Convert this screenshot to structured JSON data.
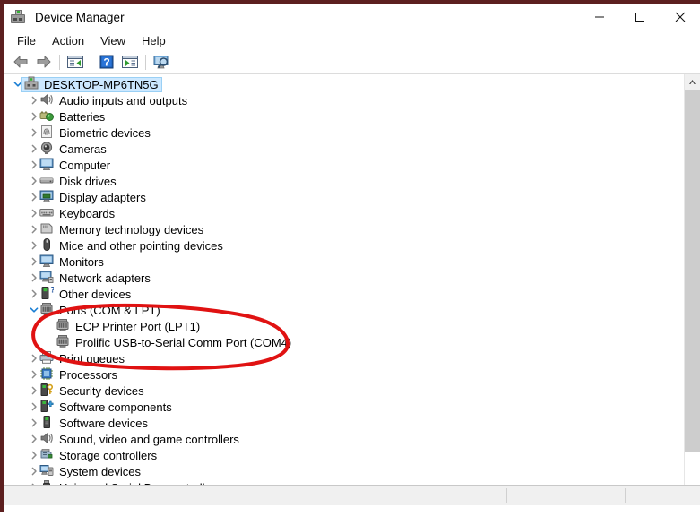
{
  "window": {
    "title": "Device Manager",
    "icon": "device-manager-icon",
    "border_color": "#5c1f1f",
    "controls": [
      {
        "name": "minimize",
        "glyph": "minimize-icon"
      },
      {
        "name": "maximize",
        "glyph": "maximize-icon"
      },
      {
        "name": "close",
        "glyph": "close-icon"
      }
    ]
  },
  "menubar": {
    "items": [
      "File",
      "Action",
      "View",
      "Help"
    ]
  },
  "toolbar": {
    "buttons": [
      {
        "name": "back-button",
        "icon": "back-arrow-icon"
      },
      {
        "name": "forward-button",
        "icon": "forward-arrow-icon"
      },
      {
        "name": "show-hide-console-tree-button",
        "icon": "console-tree-icon"
      },
      {
        "name": "help-button",
        "icon": "question-mark-icon"
      },
      {
        "name": "properties-button",
        "icon": "properties-panel-icon"
      },
      {
        "name": "scan-for-hardware-changes-button",
        "icon": "monitor-scan-icon"
      }
    ]
  },
  "tree": {
    "selected": "DESKTOP-MP6TN5G",
    "nodes": [
      {
        "label": "DESKTOP-MP6TN5G",
        "depth": 0,
        "state": "expanded",
        "icon": "computer-device-icon",
        "selected": true
      },
      {
        "label": "Audio inputs and outputs",
        "depth": 1,
        "state": "collapsed",
        "icon": "speaker-icon"
      },
      {
        "label": "Batteries",
        "depth": 1,
        "state": "collapsed",
        "icon": "battery-icon"
      },
      {
        "label": "Biometric devices",
        "depth": 1,
        "state": "collapsed",
        "icon": "fingerprint-icon"
      },
      {
        "label": "Cameras",
        "depth": 1,
        "state": "collapsed",
        "icon": "camera-icon"
      },
      {
        "label": "Computer",
        "depth": 1,
        "state": "collapsed",
        "icon": "monitor-icon"
      },
      {
        "label": "Disk drives",
        "depth": 1,
        "state": "collapsed",
        "icon": "disk-drive-icon"
      },
      {
        "label": "Display adapters",
        "depth": 1,
        "state": "collapsed",
        "icon": "display-adapter-icon"
      },
      {
        "label": "Keyboards",
        "depth": 1,
        "state": "collapsed",
        "icon": "keyboard-icon"
      },
      {
        "label": "Memory technology devices",
        "depth": 1,
        "state": "collapsed",
        "icon": "memory-card-icon"
      },
      {
        "label": "Mice and other pointing devices",
        "depth": 1,
        "state": "collapsed",
        "icon": "mouse-icon"
      },
      {
        "label": "Monitors",
        "depth": 1,
        "state": "collapsed",
        "icon": "monitor-icon"
      },
      {
        "label": "Network adapters",
        "depth": 1,
        "state": "collapsed",
        "icon": "network-adapter-icon"
      },
      {
        "label": "Other devices",
        "depth": 1,
        "state": "collapsed",
        "icon": "unknown-device-icon"
      },
      {
        "label": "Ports (COM & LPT)",
        "depth": 1,
        "state": "expanded",
        "icon": "port-icon"
      },
      {
        "label": "ECP Printer Port (LPT1)",
        "depth": 2,
        "state": "leaf",
        "icon": "port-icon"
      },
      {
        "label": "Prolific USB-to-Serial Comm Port (COM4)",
        "depth": 2,
        "state": "leaf",
        "icon": "port-icon"
      },
      {
        "label": "Print queues",
        "depth": 1,
        "state": "collapsed",
        "icon": "printer-icon"
      },
      {
        "label": "Processors",
        "depth": 1,
        "state": "collapsed",
        "icon": "processor-icon"
      },
      {
        "label": "Security devices",
        "depth": 1,
        "state": "collapsed",
        "icon": "security-key-icon"
      },
      {
        "label": "Software components",
        "depth": 1,
        "state": "collapsed",
        "icon": "software-component-icon"
      },
      {
        "label": "Software devices",
        "depth": 1,
        "state": "collapsed",
        "icon": "software-device-icon"
      },
      {
        "label": "Sound, video and game controllers",
        "depth": 1,
        "state": "collapsed",
        "icon": "speaker-icon"
      },
      {
        "label": "Storage controllers",
        "depth": 1,
        "state": "collapsed",
        "icon": "storage-controller-icon"
      },
      {
        "label": "System devices",
        "depth": 1,
        "state": "collapsed",
        "icon": "system-device-icon"
      },
      {
        "label": "Universal Serial Bus controllers",
        "depth": 1,
        "state": "collapsed",
        "icon": "usb-icon"
      }
    ]
  },
  "scrollbar": {
    "up_arrow": "scroll-up-icon",
    "orientation": "vertical"
  },
  "annotation": {
    "shape": "hand-drawn-ellipse",
    "color": "#e01212",
    "stroke_width": 4,
    "encircles": [
      "Ports (COM & LPT)",
      "ECP Printer Port (LPT1)",
      "Prolific USB-to-Serial Comm Port (COM4)"
    ]
  },
  "statusbar": {
    "text": ""
  }
}
